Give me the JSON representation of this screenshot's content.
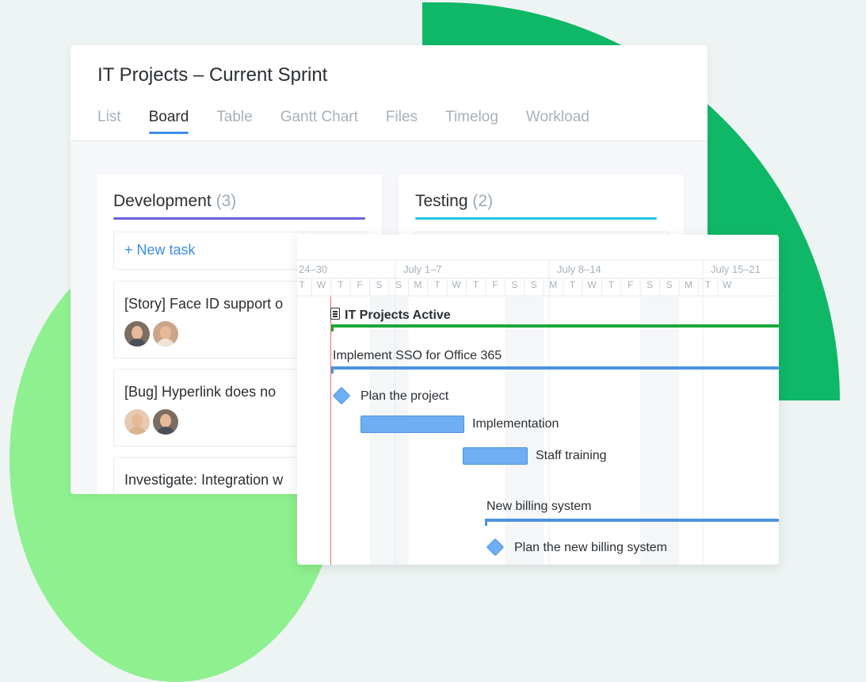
{
  "board": {
    "title": "IT Projects – Current Sprint",
    "tabs": [
      {
        "label": "List",
        "active": false
      },
      {
        "label": "Board",
        "active": true
      },
      {
        "label": "Table",
        "active": false
      },
      {
        "label": "Gantt Chart",
        "active": false
      },
      {
        "label": "Files",
        "active": false
      },
      {
        "label": "Timelog",
        "active": false
      },
      {
        "label": "Workload",
        "active": false
      }
    ],
    "columns": [
      {
        "title": "Development",
        "count": "(3)",
        "accent": "#6a61d9",
        "new_task_label": "+ New task",
        "tasks": [
          {
            "label": "[Story] Face ID support o",
            "avatars": [
              "male",
              "female"
            ]
          },
          {
            "label": "[Bug] Hyperlink does no",
            "avatars": [
              "female",
              "male"
            ]
          },
          {
            "label": "Investigate: Integration w",
            "avatars": []
          }
        ]
      },
      {
        "title": "Testing",
        "count": "(2)",
        "accent": "#22c6e6"
      }
    ]
  },
  "gantt": {
    "weeks": [
      "24–30",
      "July 1–7",
      "July 8–14",
      "July 15–21"
    ],
    "days": [
      "T",
      "W",
      "T",
      "F",
      "S",
      "S",
      "M",
      "T",
      "W",
      "T",
      "F",
      "S",
      "S",
      "M",
      "T",
      "W",
      "T",
      "F",
      "S",
      "S",
      "M",
      "T",
      "W"
    ],
    "rows": {
      "project": {
        "label": "IT Projects Active",
        "icon": "clipboard-icon",
        "color": "#1aa83a"
      },
      "sso": {
        "label": "Implement SSO for Office 365",
        "color": "#3d8de8"
      },
      "plan": {
        "label": "Plan the project"
      },
      "implementation": {
        "label": "Implementation"
      },
      "training": {
        "label": "Staff training"
      },
      "billing": {
        "label": "New billing system",
        "color": "#3d8de8"
      },
      "plan_billing": {
        "label": "Plan the new billing system"
      }
    }
  },
  "colors": {
    "primary": "#3d8de8",
    "deco_dark_green": "#0fb867",
    "deco_light_green": "#8ef08f",
    "today_line": "#ef6b6b"
  }
}
